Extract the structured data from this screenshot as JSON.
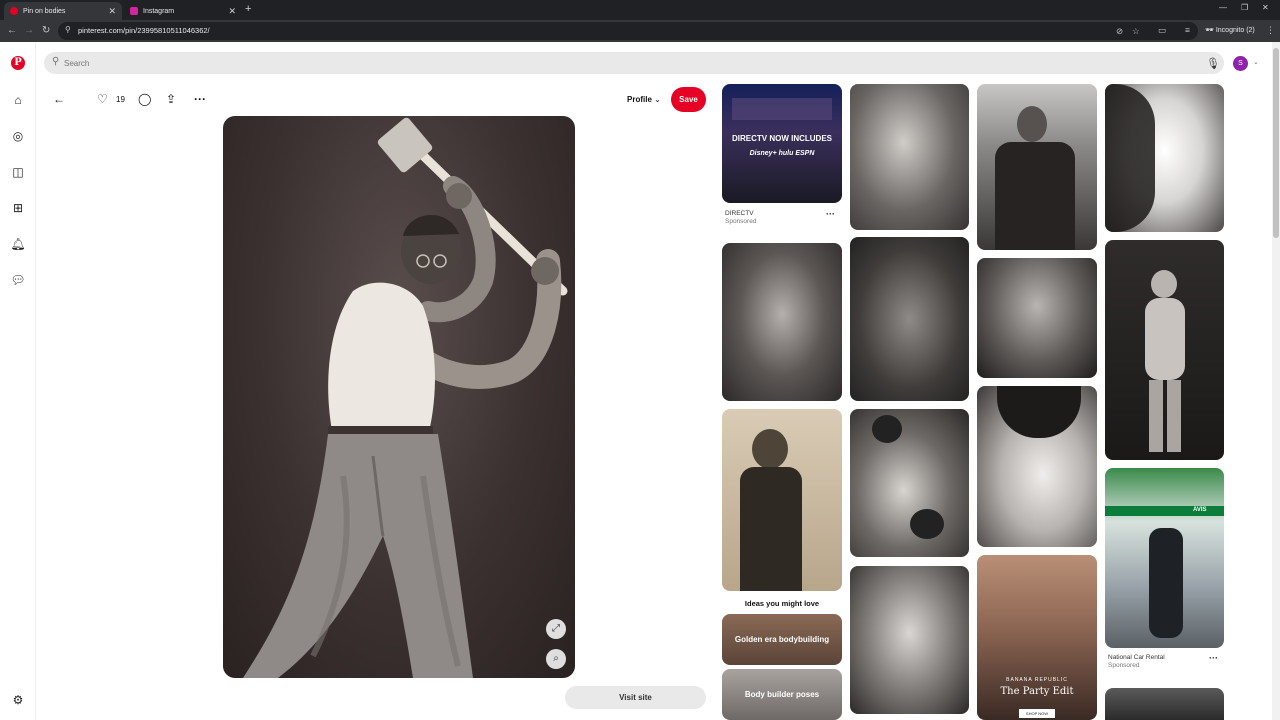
{
  "browser": {
    "tabs": [
      {
        "label": "Pin on bodies",
        "active": true,
        "favicon_color": "#e60023"
      },
      {
        "label": "Instagram",
        "active": false,
        "favicon_color": "#d6249f"
      }
    ],
    "url": "pinterest.com/pin/23995810511046362/",
    "incognito_label": "Incognito (2)"
  },
  "search": {
    "placeholder": "Search"
  },
  "account": {
    "initial": "S",
    "color": "#8e24aa"
  },
  "pin": {
    "likes": "19",
    "profile_label": "Profile",
    "save_label": "Save",
    "visit_label": "Visit site"
  },
  "grid": {
    "ad1": {
      "headline": "DIRECTV NOW INCLUDES",
      "brands": "Disney+ hulu ESPN",
      "advertiser": "DIRECTV",
      "tag": "Sponsored"
    },
    "ideas_title": "Ideas you might love",
    "boards": [
      "Golden era bodybuilding",
      "Body builder poses"
    ],
    "ad2": {
      "brand": "BANANA REPUBLIC",
      "headline": "The Party Edit",
      "cta": "SHOP NOW"
    },
    "ad3": {
      "sign": "AVIS",
      "advertiser": "National Car Rental",
      "tag": "Sponsored"
    }
  },
  "colors": {
    "brand_red": "#e60023",
    "chrome_dark": "#202124",
    "chrome_mid": "#35363a",
    "search_bg": "#e9e9e9"
  }
}
